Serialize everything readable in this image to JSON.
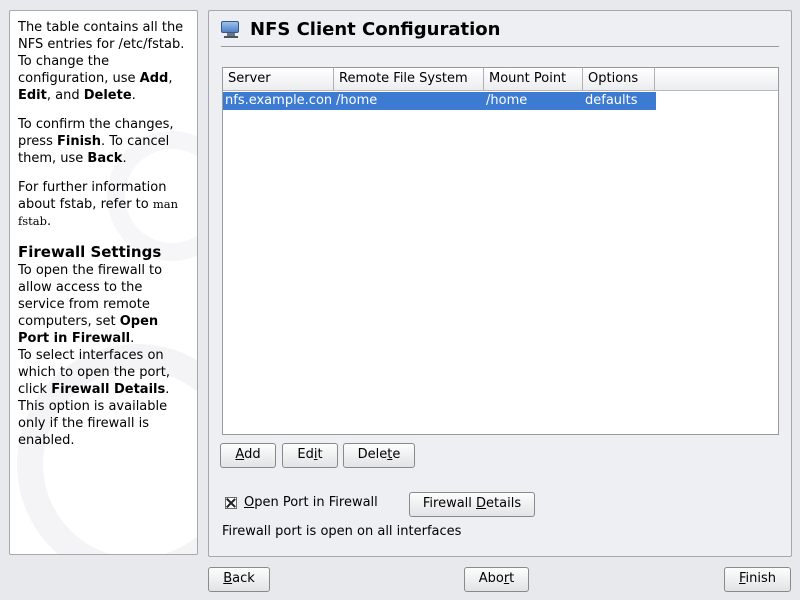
{
  "help": {
    "p1_pre": "The table contains all the NFS entries for /etc/fstab. To change the configuration, use ",
    "p1_add": "Add",
    "p1_comma": ", ",
    "p1_edit": "Edit",
    "p1_and": ", and ",
    "p1_delete": "Delete",
    "p1_end": ".",
    "p2_pre": "To confirm the changes, press ",
    "p2_finish": "Finish",
    "p2_mid": ". To cancel them, use ",
    "p2_back": "Back",
    "p2_end": ".",
    "p3_pre": "For further information about fstab, refer to ",
    "p3_man": "man fstab",
    "p3_end": ".",
    "fw_heading": "Firewall Settings",
    "fw_p1_pre": "To open the firewall to allow access to the service from remote computers, set ",
    "fw_p1_bold": "Open Port in Firewall",
    "fw_p1_end": ".",
    "fw_p2_pre": "To select interfaces on which to open the port, click ",
    "fw_p2_bold": "Firewall Details",
    "fw_p2_end": ". This option is available only if the firewall is enabled."
  },
  "header": {
    "icon": "monitor-icon",
    "title": "NFS Client Configuration"
  },
  "table": {
    "columns": [
      "Server",
      "Remote File System",
      "Mount Point",
      "Options"
    ],
    "rows": [
      [
        "nfs.example.con",
        "/home",
        "/home",
        "defaults"
      ]
    ]
  },
  "actions": {
    "add_u": "A",
    "add_rest": "dd",
    "edit_pre": "Ed",
    "edit_u": "i",
    "edit_post": "t",
    "delete_pre": "Dele",
    "delete_u": "t",
    "delete_post": "e"
  },
  "firewall": {
    "checkbox_checked": true,
    "open_port_u": "O",
    "open_port_rest": "pen Port in Firewall",
    "details_pre": "Firewall ",
    "details_u": "D",
    "details_post": "etails",
    "status": "Firewall port is open on all interfaces"
  },
  "nav": {
    "back_u": "B",
    "back_rest": "ack",
    "abort_pre": "Abo",
    "abort_u": "r",
    "abort_post": "t",
    "finish_u": "F",
    "finish_rest": "inish"
  },
  "colors": {
    "selection": "#3c7bd1",
    "panel_bg": "#eeeff2",
    "window_bg": "#e8e9ec"
  }
}
